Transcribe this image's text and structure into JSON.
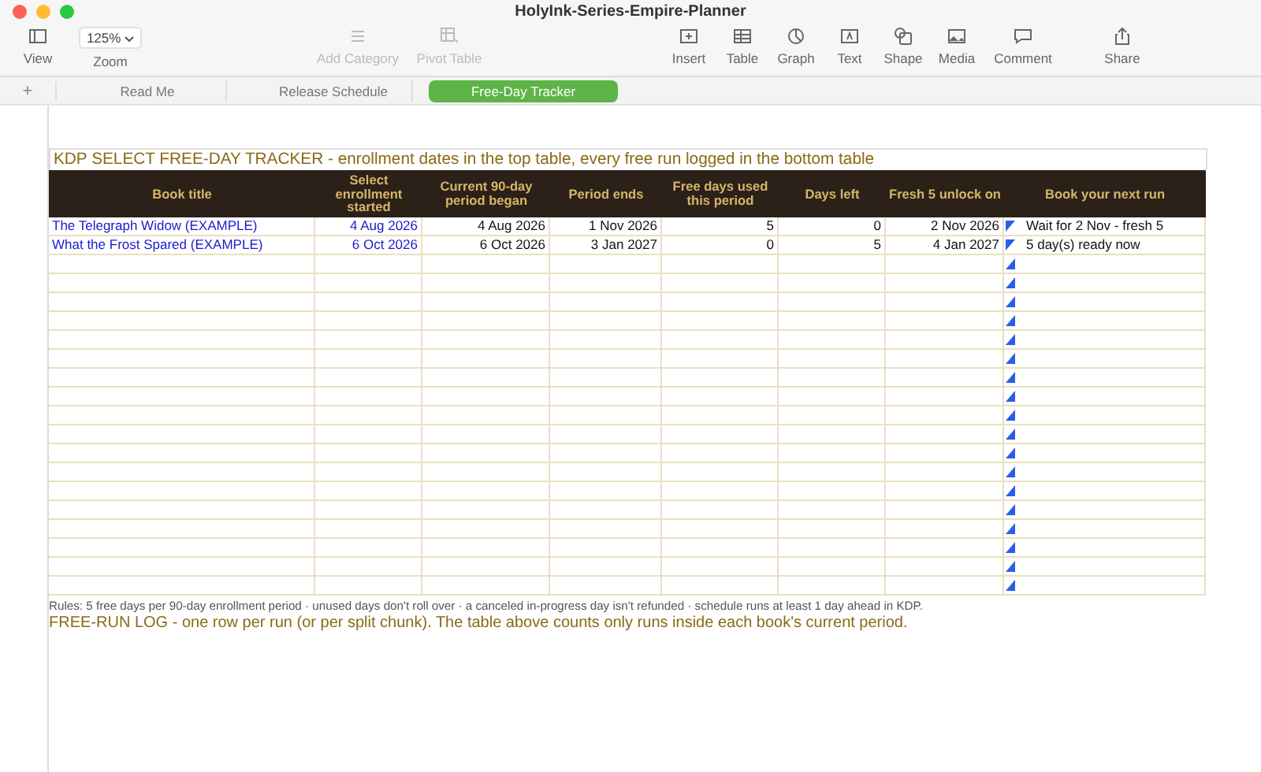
{
  "window": {
    "title": "HolyInk-Series-Empire-Planner"
  },
  "toolbar": {
    "left": [
      {
        "kind": "view",
        "label": "View"
      },
      {
        "kind": "zoom",
        "value": "125%",
        "label": "Zoom"
      }
    ],
    "middle": [
      {
        "kind": "category",
        "label": "Add Category",
        "disabled": true
      },
      {
        "kind": "pivot",
        "label": "Pivot Table",
        "disabled": true
      }
    ],
    "right": [
      {
        "kind": "insert",
        "label": "Insert",
        "disabled": false
      },
      {
        "kind": "table",
        "label": "Table",
        "disabled": false
      },
      {
        "kind": "graph",
        "label": "Graph",
        "disabled": false
      },
      {
        "kind": "text",
        "label": "Text",
        "disabled": false
      },
      {
        "kind": "shape",
        "label": "Shape",
        "disabled": false
      },
      {
        "kind": "media",
        "label": "Media",
        "disabled": false
      },
      {
        "kind": "comment",
        "label": "Comment",
        "disabled": false
      }
    ],
    "share": {
      "label": "Share"
    }
  },
  "sheet_tabs": {
    "add": "+",
    "tabs": [
      {
        "label": "Read Me",
        "selected": false
      },
      {
        "label": "Release Schedule",
        "selected": false
      },
      {
        "label": "Free-Day Tracker",
        "selected": true
      }
    ]
  },
  "sheet": {
    "heading": "KDP SELECT FREE-DAY TRACKER - enrollment dates in the top table, every free run logged in the bottom table",
    "table": {
      "columns": [
        "Book title",
        "Select enrollment started",
        "Current 90-day period began",
        "Period ends",
        "Free days used this period",
        "Days left",
        "Fresh 5 unlock on",
        "Book your next run"
      ],
      "rows": [
        [
          "The Telegraph Widow (EXAMPLE)",
          "4 Aug 2026",
          "4 Aug 2026",
          "1 Nov 2026",
          "5",
          "0",
          "2 Nov 2026",
          "Wait for 2 Nov - fresh 5"
        ],
        [
          "What the Frost Spared (EXAMPLE)",
          "6 Oct 2026",
          "6 Oct 2026",
          "3 Jan 2027",
          "0",
          "5",
          "4 Jan 2027",
          "5 day(s) ready now"
        ]
      ]
    },
    "rules": "Rules: 5 free days per 90-day enrollment period · unused days don't roll over · a canceled in-progress day isn't refunded · schedule runs at least 1 day ahead in KDP.",
    "log_heading": "FREE-RUN LOG - one row per run (or per split chunk). The table above counts only runs inside each book's current period."
  }
}
